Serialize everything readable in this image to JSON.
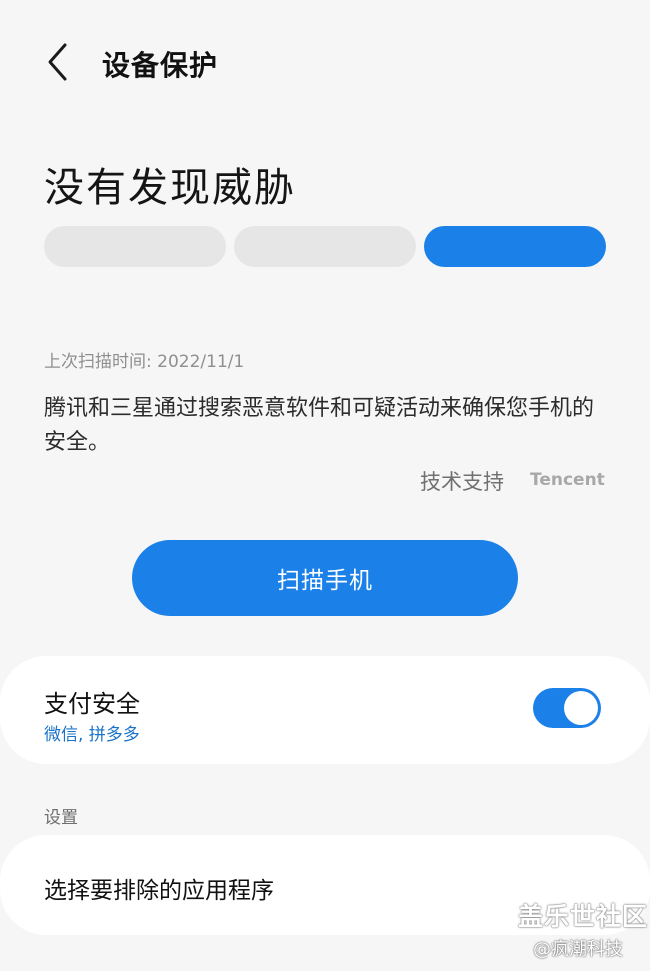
{
  "header": {
    "back_icon": "chevron-left-icon",
    "title": "设备保护"
  },
  "status": {
    "title": "没有发现威胁",
    "level_indicator": {
      "segments": 3,
      "active_segment": 3,
      "active_color": "#1b81e8",
      "inactive_color": "#e6e6e6"
    },
    "last_scan": "上次扫描时间: 2022/11/1",
    "description": "腾讯和三星通过搜索恶意软件和可疑活动来确保您手机的安全。",
    "support_link": "技术支持",
    "provider_logo": "Tencent"
  },
  "scan_button": {
    "label": "扫描手机",
    "color": "#1b81e8"
  },
  "payment_security": {
    "title": "支付安全",
    "apps": "微信, 拼多多",
    "toggle_on": true
  },
  "settings": {
    "section_label": "设置",
    "exclude_apps_label": "选择要排除的应用程序"
  },
  "watermark": {
    "main": "盖乐世社区",
    "sub": "@疯潮科技"
  }
}
